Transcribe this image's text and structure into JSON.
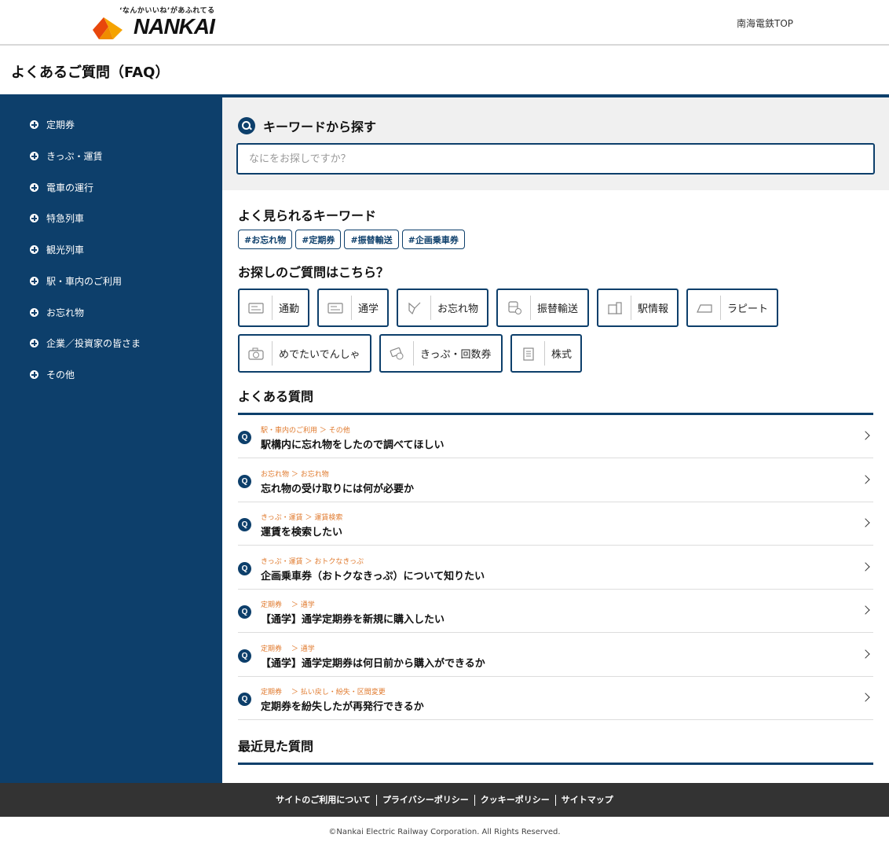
{
  "header": {
    "tagline": "‘なんかいいね’があふれてる",
    "brand": "NANKAI",
    "top_link": "南海電鉄TOP"
  },
  "page_title": "よくあるご質問（FAQ）",
  "sidebar": {
    "items": [
      {
        "label": "定期券"
      },
      {
        "label": "きっぷ・運賃"
      },
      {
        "label": "電車の運行"
      },
      {
        "label": "特急列車"
      },
      {
        "label": "観光列車"
      },
      {
        "label": "駅・車内のご利用"
      },
      {
        "label": "お忘れ物"
      },
      {
        "label": "企業／投資家の皆さま"
      },
      {
        "label": "その他"
      }
    ]
  },
  "search": {
    "heading": "キーワードから探す",
    "placeholder": "なにをお探しですか？"
  },
  "keywords": {
    "heading": "よく見られるキーワード",
    "tags": [
      "#お忘れ物",
      "#定期券",
      "#振替輸送",
      "#企画乗車券"
    ]
  },
  "categories": {
    "heading": "お探しのご質問はこちら？",
    "items": [
      {
        "label": "通勤",
        "icon": "pass-card-icon"
      },
      {
        "label": "通学",
        "icon": "student-pass-icon"
      },
      {
        "label": "お忘れ物",
        "icon": "lost-item-icon"
      },
      {
        "label": "振替輸送",
        "icon": "transfer-train-icon"
      },
      {
        "label": "駅情報",
        "icon": "station-info-icon"
      },
      {
        "label": "ラピート",
        "icon": "rapi-t-train-icon"
      },
      {
        "label": "めでたいでんしゃ",
        "icon": "camera-icon"
      },
      {
        "label": "きっぷ・回数券",
        "icon": "ticket-icon"
      },
      {
        "label": "株式",
        "icon": "building-icon"
      }
    ]
  },
  "faq": {
    "heading": "よくある質問",
    "q_mark": "Q",
    "items": [
      {
        "category": "駅・車内のご利用 ＞ その他",
        "title": "駅構内に忘れ物をしたので調べてほしい"
      },
      {
        "category": "お忘れ物 ＞ お忘れ物",
        "title": "忘れ物の受け取りには何が必要か"
      },
      {
        "category": "きっぷ・運賃 ＞ 運賃検索",
        "title": "運賃を検索したい"
      },
      {
        "category": "きっぷ・運賃 ＞ おトクなきっぷ",
        "title": "企画乗車券（おトクなきっぷ）について知りたい"
      },
      {
        "category": "定期券　 ＞ 通学",
        "title": "【通学】通学定期券を新規に購入したい"
      },
      {
        "category": "定期券　 ＞ 通学",
        "title": "【通学】通学定期券は何日前から購入ができるか"
      },
      {
        "category": "定期券　 ＞ 払い戻し・紛失・区間変更",
        "title": "定期券を紛失したが再発行できるか"
      }
    ]
  },
  "recent": {
    "heading": "最近見た質問"
  },
  "footer": {
    "links": [
      "サイトのご利用について",
      "プライバシーポリシー",
      "クッキーポリシー",
      "サイトマップ"
    ],
    "copyright": "©Nankai Electric Railway Corporation. All Rights Reserved."
  },
  "colors": {
    "navy": "#0d3f6b",
    "accent_orange": "#e07a2e",
    "logo_orange": "#f08c00",
    "logo_red": "#e8470c",
    "footer_bg": "#333333"
  }
}
